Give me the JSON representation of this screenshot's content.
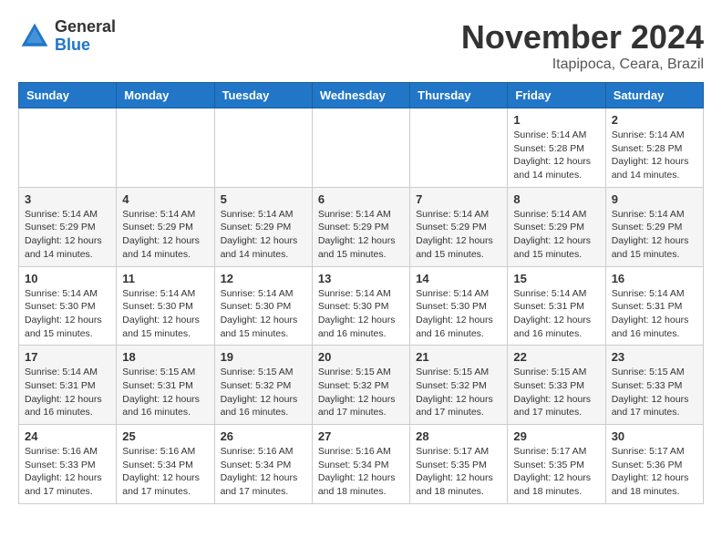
{
  "header": {
    "logo_general": "General",
    "logo_blue": "Blue",
    "month_title": "November 2024",
    "location": "Itapipoca, Ceara, Brazil"
  },
  "days_of_week": [
    "Sunday",
    "Monday",
    "Tuesday",
    "Wednesday",
    "Thursday",
    "Friday",
    "Saturday"
  ],
  "weeks": [
    {
      "days": [
        {
          "num": "",
          "info": ""
        },
        {
          "num": "",
          "info": ""
        },
        {
          "num": "",
          "info": ""
        },
        {
          "num": "",
          "info": ""
        },
        {
          "num": "",
          "info": ""
        },
        {
          "num": "1",
          "info": "Sunrise: 5:14 AM\nSunset: 5:28 PM\nDaylight: 12 hours and 14 minutes."
        },
        {
          "num": "2",
          "info": "Sunrise: 5:14 AM\nSunset: 5:28 PM\nDaylight: 12 hours and 14 minutes."
        }
      ]
    },
    {
      "days": [
        {
          "num": "3",
          "info": "Sunrise: 5:14 AM\nSunset: 5:29 PM\nDaylight: 12 hours and 14 minutes."
        },
        {
          "num": "4",
          "info": "Sunrise: 5:14 AM\nSunset: 5:29 PM\nDaylight: 12 hours and 14 minutes."
        },
        {
          "num": "5",
          "info": "Sunrise: 5:14 AM\nSunset: 5:29 PM\nDaylight: 12 hours and 14 minutes."
        },
        {
          "num": "6",
          "info": "Sunrise: 5:14 AM\nSunset: 5:29 PM\nDaylight: 12 hours and 15 minutes."
        },
        {
          "num": "7",
          "info": "Sunrise: 5:14 AM\nSunset: 5:29 PM\nDaylight: 12 hours and 15 minutes."
        },
        {
          "num": "8",
          "info": "Sunrise: 5:14 AM\nSunset: 5:29 PM\nDaylight: 12 hours and 15 minutes."
        },
        {
          "num": "9",
          "info": "Sunrise: 5:14 AM\nSunset: 5:29 PM\nDaylight: 12 hours and 15 minutes."
        }
      ]
    },
    {
      "days": [
        {
          "num": "10",
          "info": "Sunrise: 5:14 AM\nSunset: 5:30 PM\nDaylight: 12 hours and 15 minutes."
        },
        {
          "num": "11",
          "info": "Sunrise: 5:14 AM\nSunset: 5:30 PM\nDaylight: 12 hours and 15 minutes."
        },
        {
          "num": "12",
          "info": "Sunrise: 5:14 AM\nSunset: 5:30 PM\nDaylight: 12 hours and 15 minutes."
        },
        {
          "num": "13",
          "info": "Sunrise: 5:14 AM\nSunset: 5:30 PM\nDaylight: 12 hours and 16 minutes."
        },
        {
          "num": "14",
          "info": "Sunrise: 5:14 AM\nSunset: 5:30 PM\nDaylight: 12 hours and 16 minutes."
        },
        {
          "num": "15",
          "info": "Sunrise: 5:14 AM\nSunset: 5:31 PM\nDaylight: 12 hours and 16 minutes."
        },
        {
          "num": "16",
          "info": "Sunrise: 5:14 AM\nSunset: 5:31 PM\nDaylight: 12 hours and 16 minutes."
        }
      ]
    },
    {
      "days": [
        {
          "num": "17",
          "info": "Sunrise: 5:14 AM\nSunset: 5:31 PM\nDaylight: 12 hours and 16 minutes."
        },
        {
          "num": "18",
          "info": "Sunrise: 5:15 AM\nSunset: 5:31 PM\nDaylight: 12 hours and 16 minutes."
        },
        {
          "num": "19",
          "info": "Sunrise: 5:15 AM\nSunset: 5:32 PM\nDaylight: 12 hours and 16 minutes."
        },
        {
          "num": "20",
          "info": "Sunrise: 5:15 AM\nSunset: 5:32 PM\nDaylight: 12 hours and 17 minutes."
        },
        {
          "num": "21",
          "info": "Sunrise: 5:15 AM\nSunset: 5:32 PM\nDaylight: 12 hours and 17 minutes."
        },
        {
          "num": "22",
          "info": "Sunrise: 5:15 AM\nSunset: 5:33 PM\nDaylight: 12 hours and 17 minutes."
        },
        {
          "num": "23",
          "info": "Sunrise: 5:15 AM\nSunset: 5:33 PM\nDaylight: 12 hours and 17 minutes."
        }
      ]
    },
    {
      "days": [
        {
          "num": "24",
          "info": "Sunrise: 5:16 AM\nSunset: 5:33 PM\nDaylight: 12 hours and 17 minutes."
        },
        {
          "num": "25",
          "info": "Sunrise: 5:16 AM\nSunset: 5:34 PM\nDaylight: 12 hours and 17 minutes."
        },
        {
          "num": "26",
          "info": "Sunrise: 5:16 AM\nSunset: 5:34 PM\nDaylight: 12 hours and 17 minutes."
        },
        {
          "num": "27",
          "info": "Sunrise: 5:16 AM\nSunset: 5:34 PM\nDaylight: 12 hours and 18 minutes."
        },
        {
          "num": "28",
          "info": "Sunrise: 5:17 AM\nSunset: 5:35 PM\nDaylight: 12 hours and 18 minutes."
        },
        {
          "num": "29",
          "info": "Sunrise: 5:17 AM\nSunset: 5:35 PM\nDaylight: 12 hours and 18 minutes."
        },
        {
          "num": "30",
          "info": "Sunrise: 5:17 AM\nSunset: 5:36 PM\nDaylight: 12 hours and 18 minutes."
        }
      ]
    }
  ]
}
